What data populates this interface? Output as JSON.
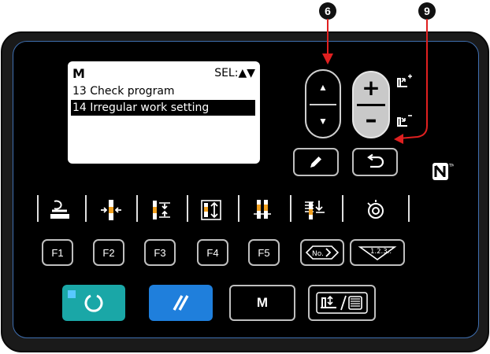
{
  "callouts": {
    "left": "6",
    "right": "9"
  },
  "lcd": {
    "mode": "M",
    "sel": "SEL:▲▼",
    "lines": [
      {
        "text": "13 Check program"
      },
      {
        "text": "14 Irregular work setting",
        "selected": true
      }
    ]
  },
  "rocker": {
    "up_symbol": "▲",
    "down_symbol": "▼"
  },
  "grey_rocker": {
    "plus": "+",
    "minus": "–"
  },
  "function_keys": [
    "F1",
    "F2",
    "F3",
    "F4",
    "F5"
  ],
  "bottom": {
    "m_label": "M"
  },
  "colors": {
    "ready": "#1aa7a7",
    "reset": "#1f7fdc",
    "panel_edge": "#3f6fb0"
  },
  "icons": [
    "pencil-icon",
    "return-icon",
    "nfc-icon",
    "presser-lift-icon",
    "needle-position-icon",
    "thread-clamp-icon",
    "pattern-icon",
    "thread-trim-icon",
    "thread-wiper-icon",
    "bobbin-winder-icon",
    "number-icon",
    "counter-icon",
    "presser-winder-icon"
  ]
}
